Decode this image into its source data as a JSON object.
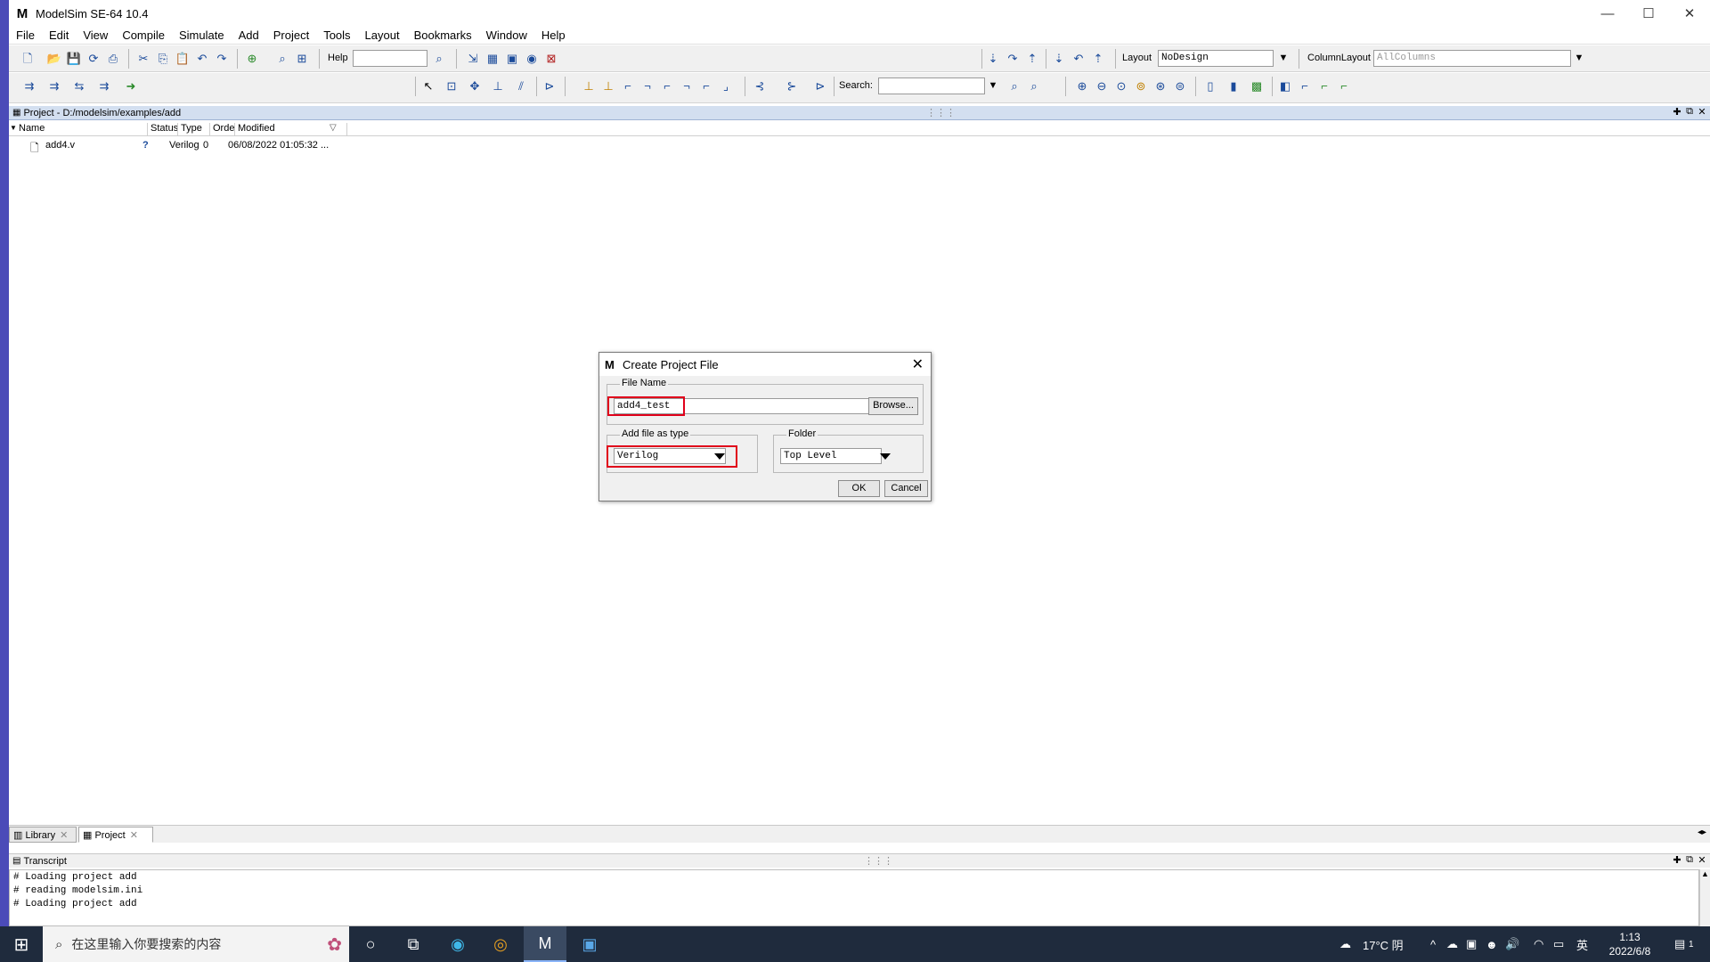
{
  "window": {
    "title": "ModelSim SE-64 10.4",
    "logo": "M",
    "minimize": "—",
    "maximize": "☐",
    "close": "✕"
  },
  "menu": [
    "File",
    "Edit",
    "View",
    "Compile",
    "Simulate",
    "Add",
    "Project",
    "Tools",
    "Layout",
    "Bookmarks",
    "Window",
    "Help"
  ],
  "toolbar": {
    "help_label": "Help",
    "help_value": "",
    "layout_label": "Layout",
    "layout_value": "NoDesign",
    "column_layout_label": "ColumnLayout",
    "column_layout_value": "AllColumns",
    "search_label": "Search:",
    "search_value": ""
  },
  "project_pane": {
    "title": "Project - D:/modelsim/examples/add",
    "columns": [
      "Name",
      "Status",
      "Type",
      "Order",
      "Modified"
    ],
    "rows": [
      {
        "name": "add4.v",
        "status_icon": "question-icon",
        "type": "Verilog",
        "order": "0",
        "modified": "06/08/2022 01:05:32 ..."
      }
    ]
  },
  "bottom_tabs": [
    {
      "label": "Library"
    },
    {
      "label": "Project"
    }
  ],
  "transcript": {
    "title": "Transcript",
    "lines": [
      "# Loading project add",
      "# reading modelsim.ini",
      "# Loading project add"
    ]
  },
  "dialog": {
    "title": "Create Project File",
    "file_name_group": "File Name",
    "file_name_value": "add4_test",
    "browse_label": "Browse...",
    "type_group": "Add file as type",
    "type_value": "Verilog",
    "folder_group": "Folder",
    "folder_value": "Top Level",
    "ok_label": "OK",
    "cancel_label": "Cancel",
    "highlight_color": "#e0001a"
  },
  "taskbar": {
    "search_placeholder": "在这里输入你要搜索的内容",
    "weather": "17°C 阴",
    "ime": "英",
    "time": "1:13",
    "date": "2022/6/8",
    "notification_count": "1"
  }
}
